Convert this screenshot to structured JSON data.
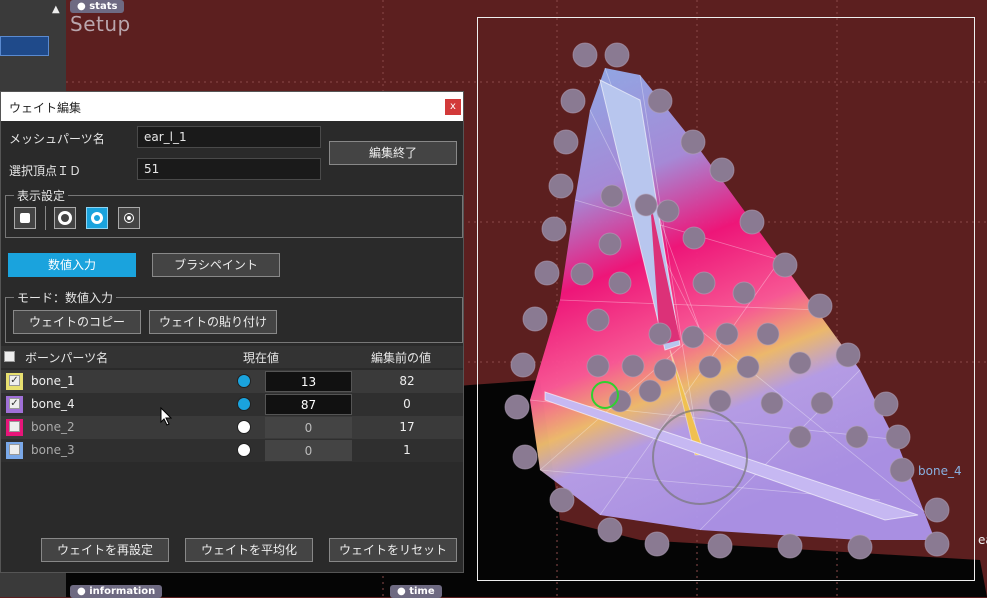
{
  "viewport": {
    "setup_title": "Setup",
    "tags": {
      "stats": "stats",
      "information": "information",
      "time": "time"
    },
    "bone_label": "bone_4",
    "edge_label": "ea"
  },
  "dialog": {
    "title": "ウェイト編集",
    "close_label": "x",
    "mesh_part_label": "メッシュパーツ名",
    "mesh_part_value": "ear_l_1",
    "vertex_id_label": "選択頂点ＩＤ",
    "vertex_id_value": "51",
    "finish_edit_label": "編集終了",
    "display_settings_label": "表示設定",
    "numeric_input_label": "数値入力",
    "brush_paint_label": "ブラシペイント",
    "mode_label": "モード：数値入力",
    "copy_weight_label": "ウェイトのコピー",
    "paste_weight_label": "ウェイトの貼り付け",
    "table": {
      "col_bone": "ボーンパーツ名",
      "col_current": "現在値",
      "col_before": "編集前の値",
      "rows": [
        {
          "name": "bone_1",
          "current": "13",
          "before": "82",
          "checked": true,
          "swatch": "#e8e070",
          "dot": "#1aa3dd"
        },
        {
          "name": "bone_4",
          "current": "87",
          "before": "0",
          "checked": true,
          "swatch": "#a070d8",
          "dot": "#1aa3dd"
        },
        {
          "name": "bone_2",
          "current": "0",
          "before": "17",
          "checked": false,
          "swatch": "#e8157a",
          "dot": "#ffffff"
        },
        {
          "name": "bone_3",
          "current": "0",
          "before": "1",
          "checked": false,
          "swatch": "#7aa8e8",
          "dot": "#ffffff"
        }
      ]
    },
    "reset_weight_label": "ウェイトを再設定",
    "average_weight_label": "ウェイトを平均化",
    "clear_weight_label": "ウェイトをリセット"
  }
}
